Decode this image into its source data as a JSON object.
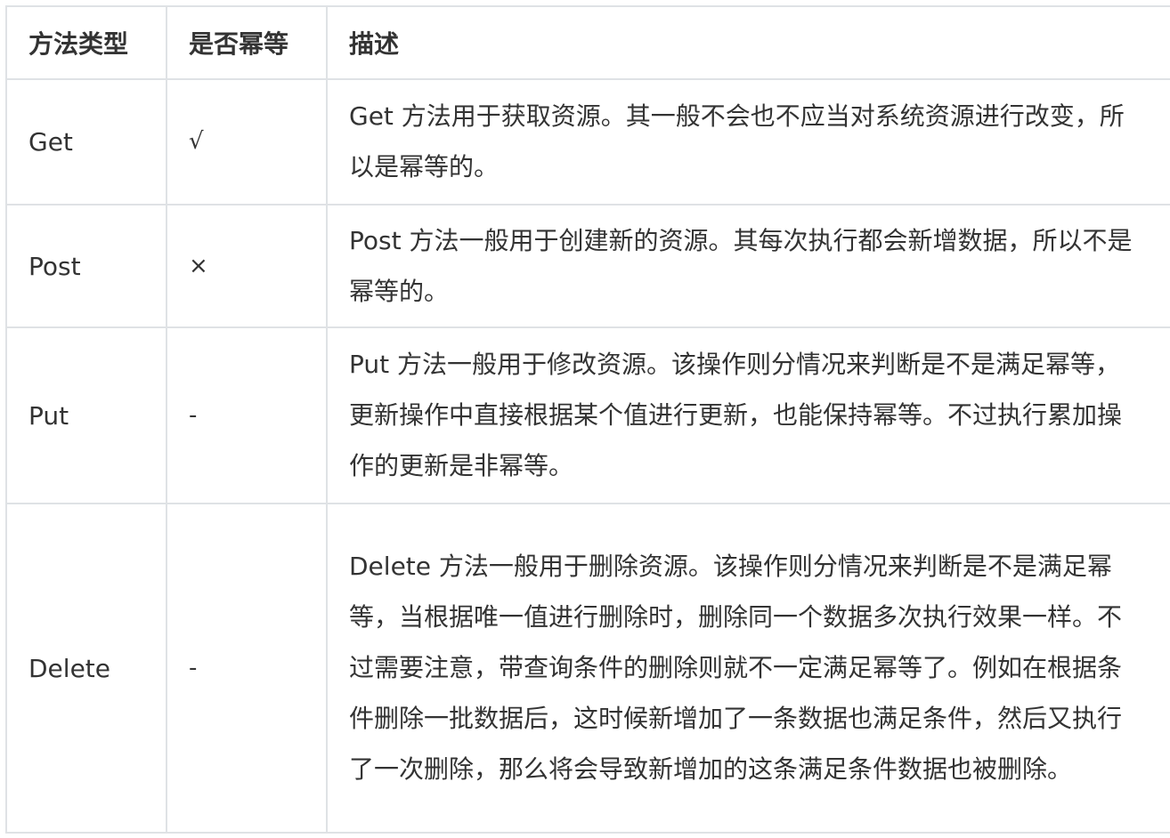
{
  "table": {
    "headers": {
      "method": "方法类型",
      "idempotent": "是否幂等",
      "description": "描述"
    },
    "rows": [
      {
        "method": "Get",
        "idempotent": "√",
        "description": "Get 方法用于获取资源。其一般不会也不应当对系统资源进行改变，所以是幂等的。"
      },
      {
        "method": "Post",
        "idempotent": "×",
        "description": "Post 方法一般用于创建新的资源。其每次执行都会新增数据，所以不是幂等的。"
      },
      {
        "method": "Put",
        "idempotent": "-",
        "description": "Put 方法一般用于修改资源。该操作则分情况来判断是不是满足幂等，更新操作中直接根据某个值进行更新，也能保持幂等。不过执行累加操作的更新是非幂等。"
      },
      {
        "method": "Delete",
        "idempotent": "-",
        "description": "Delete 方法一般用于删除资源。该操作则分情况来判断是不是满足幂等，当根据唯一值进行删除时，删除同一个数据多次执行效果一样。不过需要注意，带查询条件的删除则就不一定满足幂等了。例如在根据条件删除一批数据后，这时候新增加了一条数据也满足条件，然后又执行了一次删除，那么将会导致新增加的这条满足条件数据也被删除。"
      }
    ]
  },
  "colors": {
    "border": "#dfe2e5",
    "text": "#333333",
    "background": "#ffffff"
  }
}
